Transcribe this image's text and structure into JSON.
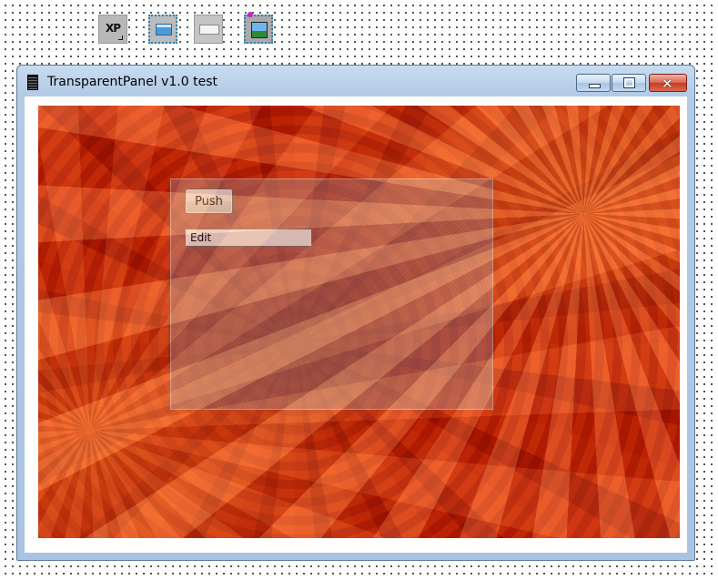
{
  "palette": {
    "items": [
      {
        "icon": "xp-manifest-icon",
        "text": "XP"
      },
      {
        "icon": "transparent-panel-icon"
      },
      {
        "icon": "edit-component-icon"
      },
      {
        "icon": "image-component-icon"
      }
    ]
  },
  "window": {
    "title": "TransparentPanel v1.0 test",
    "icon": "film-strip-icon",
    "controls": {
      "minimize_icon": "minimize-icon",
      "maximize_icon": "maximize-icon",
      "close_icon": "close-icon",
      "close_glyph": "✕"
    }
  },
  "content": {
    "background_image": "orange-chrysanthemum-flower",
    "panel": {
      "push_label": "Push",
      "edit_value": "Edit"
    }
  },
  "colors": {
    "close_button": "#c63a22",
    "title_bar": "#b3cbe6",
    "flower_orange": "#e4541c"
  }
}
